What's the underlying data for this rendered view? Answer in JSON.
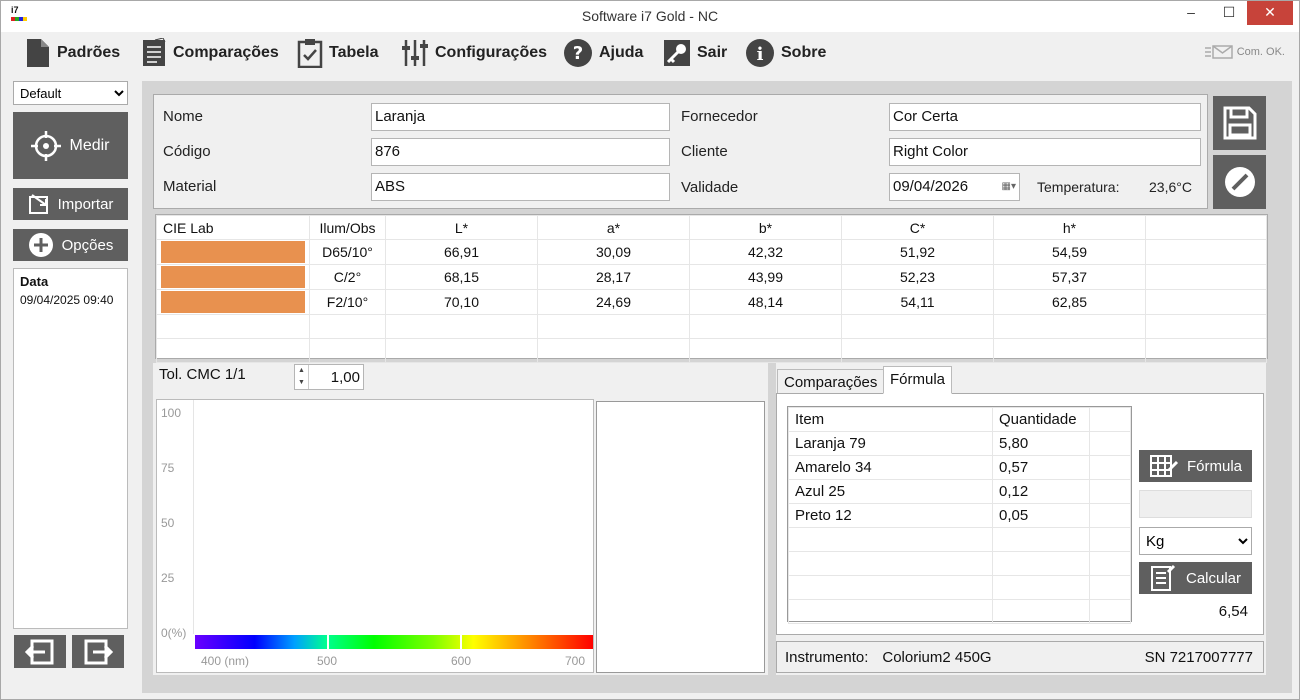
{
  "window": {
    "title": "Software i7 Gold - NC",
    "icon_text": "i7",
    "minimize": "–",
    "maximize": "☐",
    "close": "✕"
  },
  "toolbar": {
    "items": [
      {
        "label": "Padrões"
      },
      {
        "label": "Comparações"
      },
      {
        "label": "Tabela"
      },
      {
        "label": "Configurações"
      },
      {
        "label": "Ajuda"
      },
      {
        "label": "Sair"
      },
      {
        "label": "Sobre"
      }
    ],
    "status": "Com. OK."
  },
  "left": {
    "profile": "Default",
    "measure": "Medir",
    "import": "Importar",
    "options": "Opções",
    "data_header": "Data",
    "data_items": [
      "09/04/2025 09:40"
    ]
  },
  "form": {
    "name_label": "Nome",
    "name": "Laranja",
    "code_label": "Código",
    "code": "876",
    "material_label": "Material",
    "material": "ABS",
    "supplier_label": "Fornecedor",
    "supplier": "Cor Certa",
    "client_label": "Cliente",
    "client": "Right Color",
    "validity_label": "Validade",
    "validity": "09/04/2026",
    "temp_label": "Temperatura:",
    "temp": "23,6°C"
  },
  "lab": {
    "headers": [
      "CIE Lab",
      "Ilum/Obs",
      "L*",
      "a*",
      "b*",
      "C*",
      "h*"
    ],
    "swatch_color": "#E8914F",
    "rows": [
      [
        "D65/10°",
        "66,91",
        "30,09",
        "42,32",
        "51,92",
        "54,59"
      ],
      [
        "C/2°",
        "68,15",
        "28,17",
        "43,99",
        "52,23",
        "57,37"
      ],
      [
        "F2/10°",
        "70,10",
        "24,69",
        "48,14",
        "54,11",
        "62,85"
      ]
    ]
  },
  "tolerance": {
    "label": "Tol. CMC 1/1",
    "value": "1,00"
  },
  "spectrum": {
    "y_ticks": [
      "100",
      "75",
      "50",
      "25",
      "0(%)"
    ],
    "x_ticks": [
      "400 (nm)",
      "500",
      "600",
      "700"
    ]
  },
  "tabs": {
    "comparisons": "Comparações",
    "formula": "Fórmula"
  },
  "formula": {
    "headers": [
      "Item",
      "Quantidade"
    ],
    "rows": [
      [
        "Laranja 79",
        "5,80"
      ],
      [
        "Amarelo 34",
        "0,57"
      ],
      [
        "Azul 25",
        "0,12"
      ],
      [
        "Preto 12",
        "0,05"
      ]
    ],
    "formula_btn": "Fórmula",
    "unit": "Kg",
    "calc_btn": "Calcular",
    "total": "6,54"
  },
  "instrument": {
    "label": "Instrumento:",
    "name": "Colorium2 450G",
    "serial": "SN 7217007777"
  }
}
